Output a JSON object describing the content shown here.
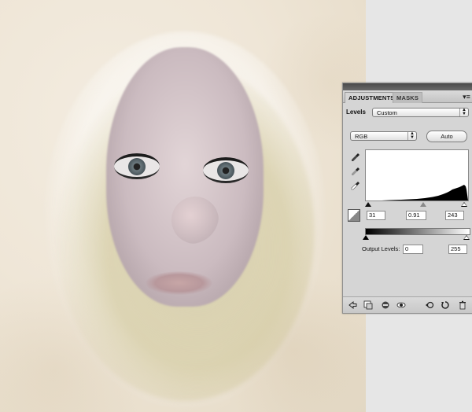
{
  "panel": {
    "tabs": [
      "ADJUSTMENTS",
      "MASKS"
    ],
    "menu_icon": "panel-menu-icon",
    "adjustment_name": "Levels",
    "preset_value": "Custom",
    "channel_value": "RGB",
    "auto_label": "Auto",
    "input_levels": {
      "black": "31",
      "gamma": "0.91",
      "white": "243"
    },
    "output_label": "Output Levels:",
    "output_levels": {
      "black": "0",
      "white": "255"
    },
    "icons": {
      "eyedroppers": [
        "black-eyedropper-icon",
        "gray-eyedropper-icon",
        "white-eyedropper-icon"
      ],
      "toolbar": [
        "return-icon",
        "clip-layer-icon",
        "visibility-toggle-icon",
        "eye-icon",
        "previous-state-icon",
        "reset-icon",
        "trash-icon"
      ]
    }
  },
  "colors": {
    "panel_bg": "#d5d5d5",
    "canvas_paper": "#efe6d7"
  }
}
